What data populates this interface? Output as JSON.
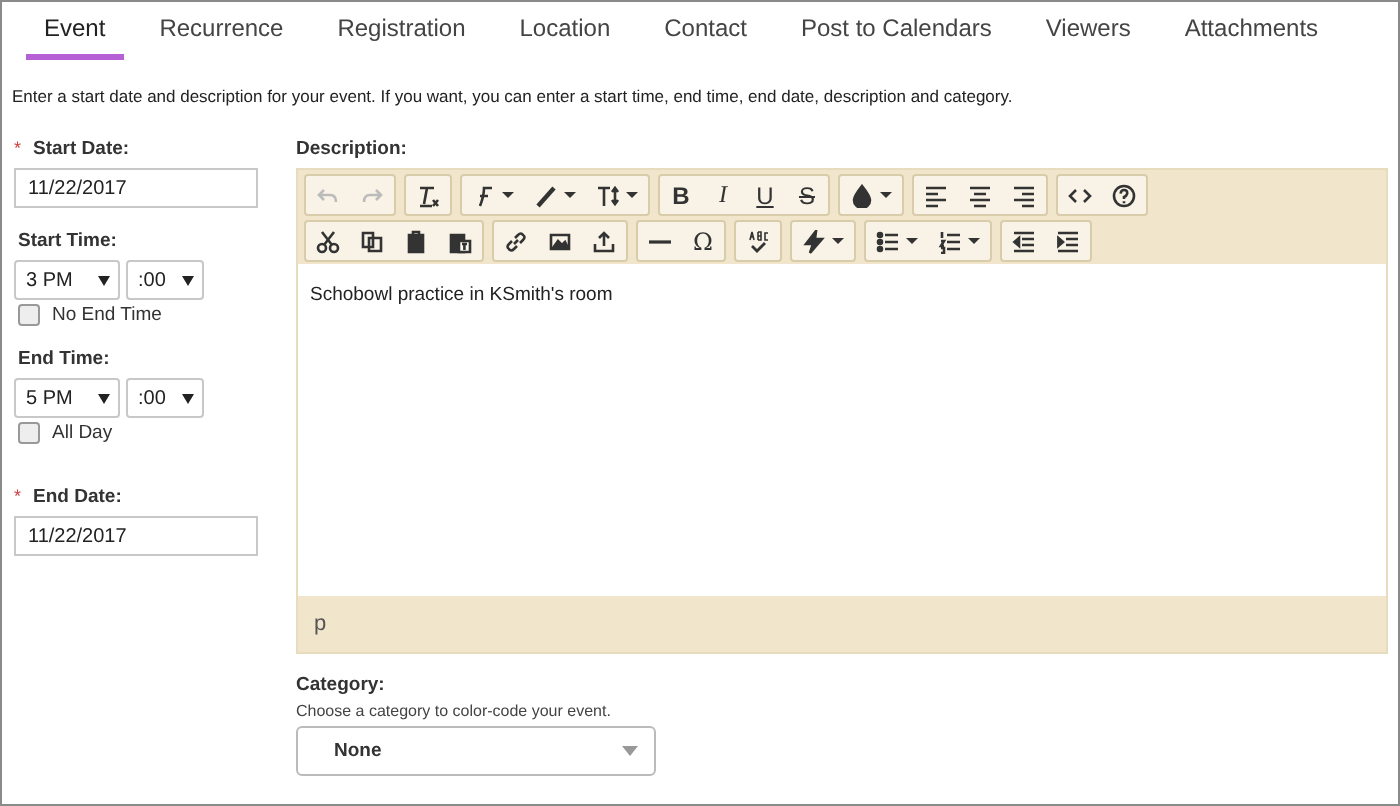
{
  "tabs": [
    {
      "label": "Event",
      "selected": true
    },
    {
      "label": "Recurrence",
      "selected": false
    },
    {
      "label": "Registration",
      "selected": false
    },
    {
      "label": "Location",
      "selected": false
    },
    {
      "label": "Contact",
      "selected": false
    },
    {
      "label": "Post to Calendars",
      "selected": false
    },
    {
      "label": "Viewers",
      "selected": false
    },
    {
      "label": "Attachments",
      "selected": false
    }
  ],
  "instructions": "Enter a start date and description for your event. If you want, you can enter a start time, end time, end date, description and category.",
  "start_date": {
    "marker": "*",
    "label": "Start Date:",
    "value": "11/22/2017"
  },
  "start_time": {
    "label": "Start Time:",
    "hour": "3 PM",
    "minute": ":00",
    "checkbox": {
      "label": "No End Time",
      "checked": false
    }
  },
  "end_time": {
    "label": "End Time:",
    "hour": "5 PM",
    "minute": ":00",
    "checkbox": {
      "label": "All Day",
      "checked": false
    }
  },
  "end_date": {
    "marker": "*",
    "label": "End Date:",
    "value": "11/22/2017"
  },
  "description": {
    "label": "Description:",
    "toolbar": [
      [
        [
          {
            "kind": "undo",
            "disabled": true
          },
          {
            "kind": "redo",
            "disabled": true
          }
        ],
        [
          {
            "kind": "clear-format",
            "disabled": false
          }
        ],
        [
          {
            "kind": "font",
            "disabled": false
          },
          {
            "kind": "pen",
            "disabled": false
          },
          {
            "kind": "text-height",
            "disabled": false
          }
        ],
        [
          {
            "kind": "bold",
            "label": "B",
            "disabled": false
          },
          {
            "kind": "italic",
            "label": "I",
            "disabled": false
          },
          {
            "kind": "underline",
            "label": "U",
            "disabled": false
          },
          {
            "kind": "strike",
            "label": "S",
            "disabled": false
          }
        ],
        [
          {
            "kind": "color",
            "disabled": false
          }
        ],
        [
          {
            "kind": "align-left",
            "disabled": false
          },
          {
            "kind": "align-center",
            "disabled": false
          },
          {
            "kind": "align-right",
            "disabled": false
          }
        ],
        [
          {
            "kind": "source",
            "disabled": false
          },
          {
            "kind": "help",
            "disabled": false
          }
        ]
      ],
      [
        [
          {
            "kind": "cut",
            "disabled": false
          },
          {
            "kind": "copy",
            "disabled": false
          },
          {
            "kind": "paste",
            "disabled": false
          },
          {
            "kind": "paste-text",
            "disabled": false
          }
        ],
        [
          {
            "kind": "link",
            "disabled": false
          },
          {
            "kind": "image",
            "disabled": false
          },
          {
            "kind": "upload",
            "disabled": false
          }
        ],
        [
          {
            "kind": "hr",
            "disabled": false
          },
          {
            "kind": "special-char",
            "label": "Ω",
            "disabled": false
          }
        ],
        [
          {
            "kind": "spellcheck",
            "disabled": false
          }
        ],
        [
          {
            "kind": "flash",
            "disabled": false
          }
        ],
        [
          {
            "kind": "bullet-list",
            "disabled": false
          },
          {
            "kind": "number-list",
            "disabled": false
          }
        ],
        [
          {
            "kind": "outdent",
            "disabled": false
          },
          {
            "kind": "indent",
            "disabled": false
          }
        ]
      ]
    ],
    "content": "Schobowl practice in KSmith's room",
    "element_path": "p"
  },
  "category": {
    "label": "Category:",
    "hint": "Choose a category to color-code your event.",
    "value": "None"
  }
}
